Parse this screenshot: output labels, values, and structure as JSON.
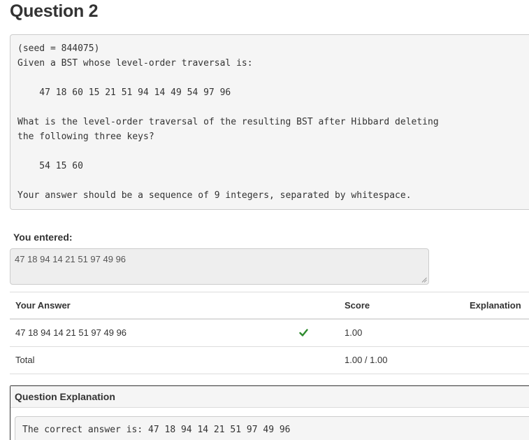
{
  "question": {
    "title": "Question 2",
    "prompt_lines": [
      "(seed = 844075)",
      "Given a BST whose level-order traversal is:",
      "",
      "    47 18 60 15 21 51 94 14 49 54 97 96",
      "",
      "What is the level-order traversal of the resulting BST after Hibbard deleting",
      "the following three keys?",
      "",
      "    54 15 60",
      "",
      "Your answer should be a sequence of 9 integers, separated by whitespace."
    ]
  },
  "response": {
    "label": "You entered:",
    "value": "47 18 94 14 21 51 97 49 96"
  },
  "grading": {
    "headers": {
      "answer": "Your Answer",
      "score": "Score",
      "explanation": "Explanation"
    },
    "rows": [
      {
        "answer": "47 18 94 14 21 51 97 49 96",
        "correct_icon": "check-icon",
        "score": "1.00",
        "explanation": ""
      }
    ],
    "total": {
      "label": "Total",
      "score": "1.00 / 1.00"
    }
  },
  "explanation_panel": {
    "heading": "Question Explanation",
    "text": "The correct answer is: 47 18 94 14 21 51 97 49 96"
  },
  "colors": {
    "check": "#2e8b2e",
    "panel_bg": "#f5f5f5",
    "border": "#cccccc"
  }
}
